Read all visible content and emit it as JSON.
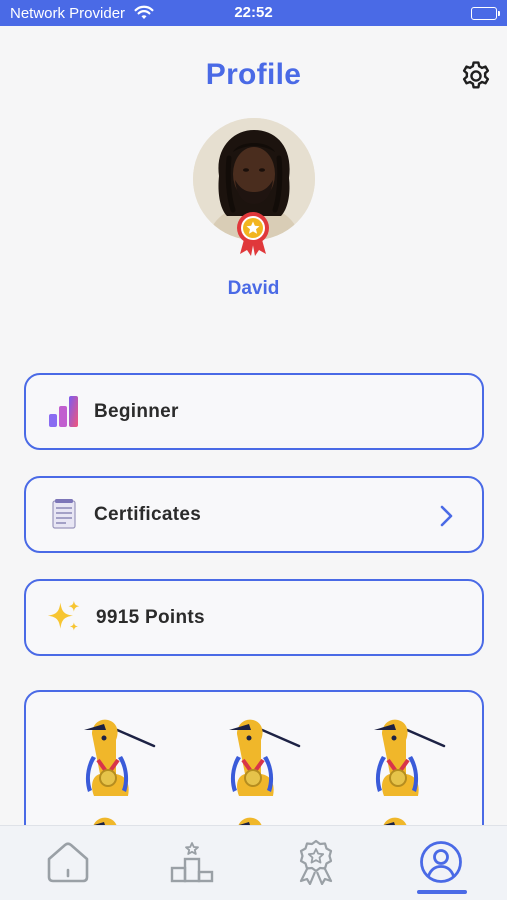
{
  "status_bar": {
    "carrier": "Network Provider",
    "time": "22:52"
  },
  "header": {
    "title": "Profile"
  },
  "profile": {
    "name": "David"
  },
  "cards": {
    "level": {
      "label": "Beginner"
    },
    "certificates": {
      "label": "Certificates"
    },
    "points": {
      "label": "9915 Points"
    }
  },
  "badges": {
    "count_visible": 6,
    "icon": "kiwi-bird-medal-icon"
  },
  "tab_bar": {
    "tabs": [
      {
        "icon": "home-icon",
        "active": false
      },
      {
        "icon": "leaderboard-icon",
        "active": false
      },
      {
        "icon": "award-icon",
        "active": false
      },
      {
        "icon": "profile-icon",
        "active": true
      }
    ]
  },
  "colors": {
    "accent": "#4a6ae6",
    "background": "#f6f6f7",
    "tab_bar": "#f1f3f7",
    "badge_yellow": "#f0b72a"
  }
}
